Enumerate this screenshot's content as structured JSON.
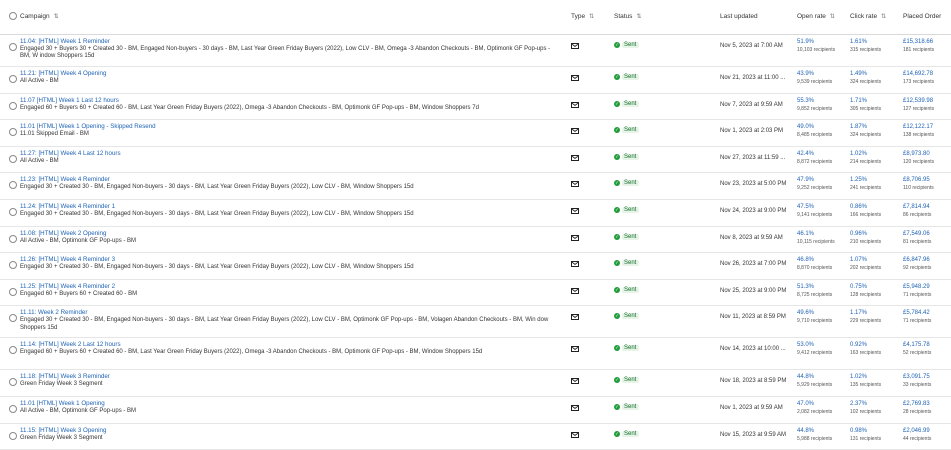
{
  "header": {
    "campaign": "Campaign",
    "type": "Type",
    "status": "Status",
    "last_updated": "Last updated",
    "open_rate": "Open rate",
    "click_rate": "Click rate",
    "placed_order": "Placed Order"
  },
  "rows": [
    {
      "title": "11.04: [HTML] Week 1 Reminder",
      "segments": "Engaged 30 + Buyers 30 + Created 30 - BM, Engaged Non-buyers - 30 days - BM, Last Year Green Friday Buyers (2022), Low CLV - BM, Omega -3 Abandon Checkouts - BM, Optimonk GF Pop-ups - BM, W indow Shoppers 15d",
      "status": "Sent",
      "updated": "Nov 5, 2023 at 7:00 AM",
      "open": "51.9%",
      "open_sub": "10,103 recipients",
      "click": "1.61%",
      "click_sub": "315 recipients",
      "order": "£15,318.66",
      "order_sub": "181 recipients"
    },
    {
      "title": "11.21: [HTML] Week 4 Opening",
      "segments": "All Active - BM",
      "status": "Sent",
      "updated": "Nov 21, 2023 at 11:00 ...",
      "open": "43.9%",
      "open_sub": "9,539 recipients",
      "click": "1.49%",
      "click_sub": "324 recipients",
      "order": "£14,692.78",
      "order_sub": "173 recipients"
    },
    {
      "title": "11.07 [HTML] Week 1 Last 12 hours",
      "segments": "Engaged 60 + Buyers 60 + Created 60 - BM, Last Year Green Friday Buyers (2022), Omega -3 Abandon Checkouts - BM, Optimonk GF Pop-ups - BM, Window Shoppers 7d",
      "status": "Sent",
      "updated": "Nov 7, 2023 at 9:59 AM",
      "open": "55.3%",
      "open_sub": "9,852 recipients",
      "click": "1.71%",
      "click_sub": "305 recipients",
      "order": "£12,539.98",
      "order_sub": "127 recipients"
    },
    {
      "title": "11.01 [HTML] Week 1 Opening - Skipped Resend",
      "segments": "11.01 Skipped Email - BM",
      "status": "Sent",
      "updated": "Nov 1, 2023 at 2:03 PM",
      "open": "49.0%",
      "open_sub": "8,485 recipients",
      "click": "1.87%",
      "click_sub": "324 recipients",
      "order": "£12,122.17",
      "order_sub": "138 recipients"
    },
    {
      "title": "11.27: [HTML] Week 4 Last 12 hours",
      "segments": "All Active - BM",
      "status": "Sent",
      "updated": "Nov 27, 2023 at 11:59 ...",
      "open": "42.4%",
      "open_sub": "8,872 recipients",
      "click": "1.02%",
      "click_sub": "214 recipients",
      "order": "£8,973.80",
      "order_sub": "120 recipients"
    },
    {
      "title": "11.23: [HTML] Week 4 Reminder",
      "segments": "Engaged 30 + Created 30 - BM, Engaged Non-buyers - 30 days - BM, Last Year Green Friday Buyers (2022), Low CLV - BM, Window Shoppers 15d",
      "status": "Sent",
      "updated": "Nov 23, 2023 at 5:00 PM",
      "open": "47.9%",
      "open_sub": "9,252 recipients",
      "click": "1.25%",
      "click_sub": "241 recipients",
      "order": "£8,706.95",
      "order_sub": "110 recipients"
    },
    {
      "title": "11.24: [HTML] Week 4 Reminder 1",
      "segments": "Engaged 30 + Created 30 - BM, Engaged Non-buyers - 30 days - BM, Last Year Green Friday Buyers (2022), Low CLV - BM, Window Shoppers 15d",
      "status": "Sent",
      "updated": "Nov 24, 2023 at 9:00 PM",
      "open": "47.5%",
      "open_sub": "9,141 recipients",
      "click": "0.86%",
      "click_sub": "166 recipients",
      "order": "£7,814.94",
      "order_sub": "86 recipients"
    },
    {
      "title": "11.08: [HTML] Week 2 Opening",
      "segments": "All Active - BM, Optimonk GF Pop-ups - BM",
      "status": "Sent",
      "updated": "Nov 8, 2023 at 9:59 AM",
      "open": "46.1%",
      "open_sub": "10,115 recipients",
      "click": "0.96%",
      "click_sub": "210 recipients",
      "order": "£7,549.06",
      "order_sub": "81 recipients"
    },
    {
      "title": "11.26: [HTML] Week 4 Reminder 3",
      "segments": "Engaged 30 + Created 30 - BM, Engaged Non-buyers - 30 days - BM, Last Year Green Friday Buyers (2022), Low CLV - BM, Window Shoppers 15d",
      "status": "Sent",
      "updated": "Nov 26, 2023 at 7:00 PM",
      "open": "46.8%",
      "open_sub": "8,870 recipients",
      "click": "1.07%",
      "click_sub": "202 recipients",
      "order": "£6,847.96",
      "order_sub": "92 recipients"
    },
    {
      "title": "11.25: [HTML] Week 4 Reminder 2",
      "segments": "Engaged 60 + Buyers 60 + Created 60 - BM",
      "status": "Sent",
      "updated": "Nov 25, 2023 at 9:00 PM",
      "open": "51.3%",
      "open_sub": "8,725 recipients",
      "click": "0.75%",
      "click_sub": "128 recipients",
      "order": "£5,948.29",
      "order_sub": "71 recipients"
    },
    {
      "title": "11.11: Week 2 Reminder",
      "segments": "Engaged 30 + Created 30 - BM, Engaged Non-buyers - 30 days - BM, Last Year Green Friday Buyers (2022), Low CLV - BM, Optimonk GF Pop-ups - BM, Volagen Abandon Checkouts - BM, Win dow Shoppers 15d",
      "status": "Sent",
      "updated": "Nov 11, 2023 at 8:59 PM",
      "open": "49.6%",
      "open_sub": "9,710 recipients",
      "click": "1.17%",
      "click_sub": "229 recipients",
      "order": "£5,784.42",
      "order_sub": "71 recipients"
    },
    {
      "title": "11.14: [HTML] Week 2 Last 12 hours",
      "segments": "Engaged 60 + Buyers 60 + Created 60 - BM, Last Year Green Friday Buyers (2022), Omega -3 Abandon Checkouts - BM, Optimonk GF Pop-ups - BM, Window Shoppers 15d",
      "status": "Sent",
      "updated": "Nov 14, 2023 at 10:00 ...",
      "open": "53.0%",
      "open_sub": "9,412 recipients",
      "click": "0.92%",
      "click_sub": "163 recipients",
      "order": "£4,175.78",
      "order_sub": "52 recipients"
    },
    {
      "title": "11.18: [HTML] Week 3 Reminder",
      "segments": "Green Friday Week 3 Segment",
      "status": "Sent",
      "updated": "Nov 18, 2023 at 8:59 PM",
      "open": "44.8%",
      "open_sub": "5,929 recipients",
      "click": "1.02%",
      "click_sub": "135 recipients",
      "order": "£3,091.75",
      "order_sub": "33 recipients"
    },
    {
      "title": "11.01 [HTML] Week 1 Opening",
      "segments": "All Active - BM, Optimonk GF Pop-ups - BM",
      "status": "Sent",
      "updated": "Nov 1, 2023 at 9:59 AM",
      "open": "47.0%",
      "open_sub": "2,082 recipients",
      "click": "2.37%",
      "click_sub": "102 recipients",
      "order": "£2,769.83",
      "order_sub": "28 recipients"
    },
    {
      "title": "11.15: [HTML] Week 3 Opening",
      "segments": "Green Friday Week 3 Segment",
      "status": "Sent",
      "updated": "Nov 15, 2023 at 9:59 AM",
      "open": "44.8%",
      "open_sub": "5,988 recipients",
      "click": "0.98%",
      "click_sub": "131 recipients",
      "order": "£2,046.99",
      "order_sub": "44 recipients"
    }
  ]
}
